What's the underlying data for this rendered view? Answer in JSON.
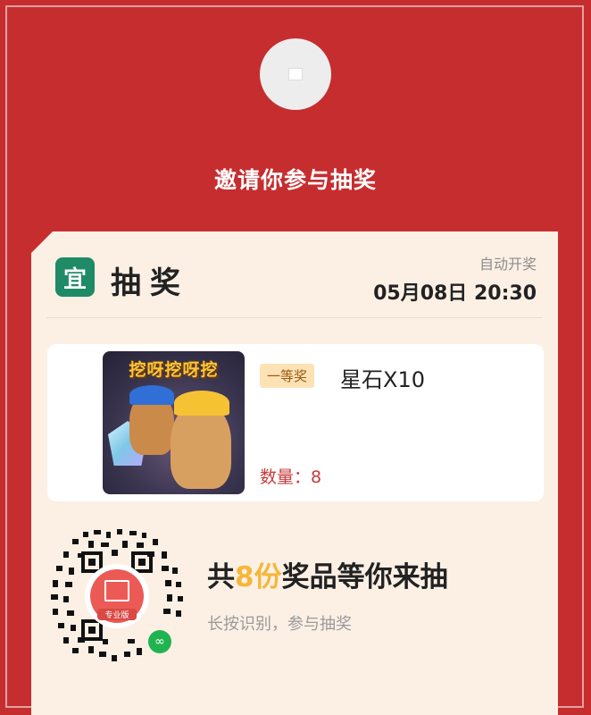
{
  "header": {
    "invite_title": "邀请你参与抽奖"
  },
  "card": {
    "logo_char": "宜",
    "lottery_label": "抽奖",
    "auto_open_label": "自动开奖",
    "draw_time": "05月08日 20:30"
  },
  "prize": {
    "game_title": "挖呀挖呀挖",
    "tier": "一等奖",
    "name": "星石X10",
    "quantity_label": "数量：8"
  },
  "share": {
    "title_prefix": "共",
    "count": "8份",
    "title_suffix": "奖品等你来抽",
    "subtitle": "长按识别，参与抽奖",
    "qr_badge": "专业版"
  },
  "colors": {
    "background": "#c62d2f",
    "card": "#fcf0e5",
    "logo": "#1f8a66",
    "highlight": "#f5b73b",
    "quantity": "#c83a3a"
  }
}
